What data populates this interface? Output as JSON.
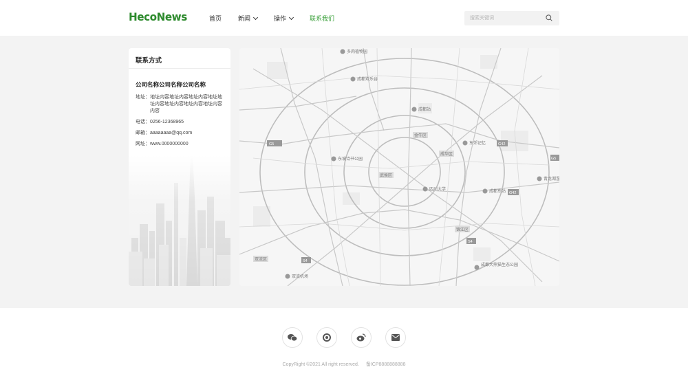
{
  "header": {
    "logo": "HecoNews",
    "nav": [
      {
        "label": "首页",
        "has_dropdown": false,
        "active": false
      },
      {
        "label": "新闻",
        "has_dropdown": true,
        "active": false
      },
      {
        "label": "操作",
        "has_dropdown": true,
        "active": false
      },
      {
        "label": "联系我们",
        "has_dropdown": false,
        "active": true
      }
    ],
    "search": {
      "placeholder": "搜索关键词",
      "value": ""
    }
  },
  "contact": {
    "title": "联系方式",
    "company": "公司名称公司名称公司名称",
    "address_label": "地址：",
    "address": "地址内容地址内容地址内容地址地址内容地址内容地址内容地址内容内容",
    "phone_label": "电话：",
    "phone": "0256-12368965",
    "email_label": "邮箱：",
    "email": "aaaaaaaa@qq.com",
    "website_label": "网址：",
    "website": "www.0000000000"
  },
  "map": {
    "labels": {
      "poi1": "多肉植物园",
      "poi2": "成都欢乐谷",
      "poi3": "成都站",
      "poi4": "金牛区",
      "poi5": "成华区",
      "poi6": "东郊记忆",
      "poi7": "东坡诗书公园",
      "poi8": "锦江区",
      "poi9": "武侯区",
      "poi10": "四川大学",
      "poi11": "成都东站",
      "poi12": "青龙湖湿地",
      "poi13": "高新区",
      "poi14": "双流区",
      "poi15": "双流机场",
      "poi16": "成都大熊猫生态公园",
      "road1": "G5",
      "road2": "G42",
      "road3": "G5",
      "road4": "G42",
      "road5": "G76",
      "road6": "S4",
      "road7": "S4"
    }
  },
  "footer": {
    "icons": [
      "wechat-icon",
      "moments-icon",
      "weibo-icon",
      "mail-icon"
    ],
    "copyright": "CopyRight ©2021 All right reserved.",
    "icp": "备ICP8888888888"
  }
}
